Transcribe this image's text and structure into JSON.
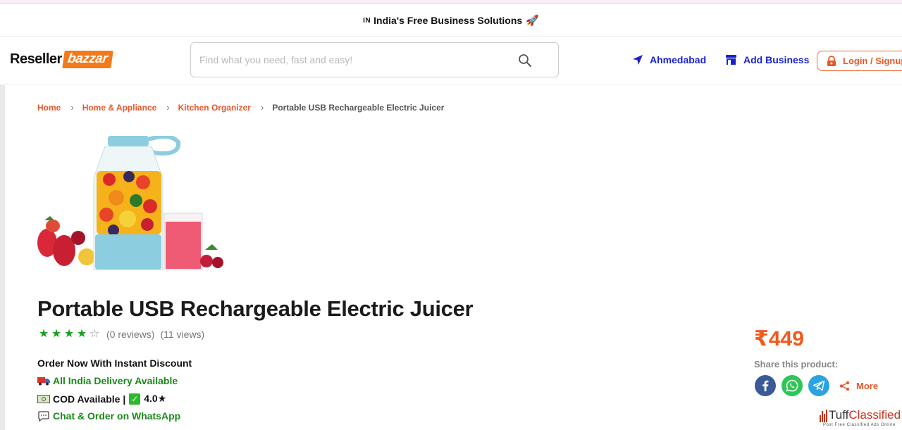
{
  "announcement": {
    "flag": "IN",
    "text": "India's Free Business Solutions",
    "emoji": "🚀"
  },
  "header": {
    "logo_main": "Reseller",
    "logo_accent": "bazzar",
    "search_placeholder": "Find what you need, fast and easy!",
    "search_value": "",
    "location": "Ahmedabad",
    "add_business": "Add Business",
    "login": "Login / Signup"
  },
  "breadcrumb": {
    "items": [
      "Home",
      "Home & Appliance",
      "Kitchen Organizer"
    ],
    "current": "Portable USB Rechargeable Electric Juicer"
  },
  "product": {
    "title": "Portable USB Rechargeable Electric Juicer",
    "rating_stars": 4,
    "rating_max": 5,
    "reviews": "(0 reviews)",
    "views": "(11 views)",
    "offer": "Order Now With Instant Discount",
    "delivery": "All India Delivery Available",
    "cod": "COD Available |",
    "cod_rating": "4.0★",
    "whatsapp": "Chat & Order on WhatsApp",
    "price": "₹449"
  },
  "share": {
    "label": "Share this product:",
    "more": "More"
  },
  "watermark": {
    "brand_a": "Tuff",
    "brand_b": "Classified",
    "tagline": "Post Free Classified Ads Online"
  },
  "colors": {
    "accent": "#e8572a",
    "nav_blue": "#1a23c9",
    "rating_green": "#15a01e",
    "price": "#f05a1e"
  }
}
